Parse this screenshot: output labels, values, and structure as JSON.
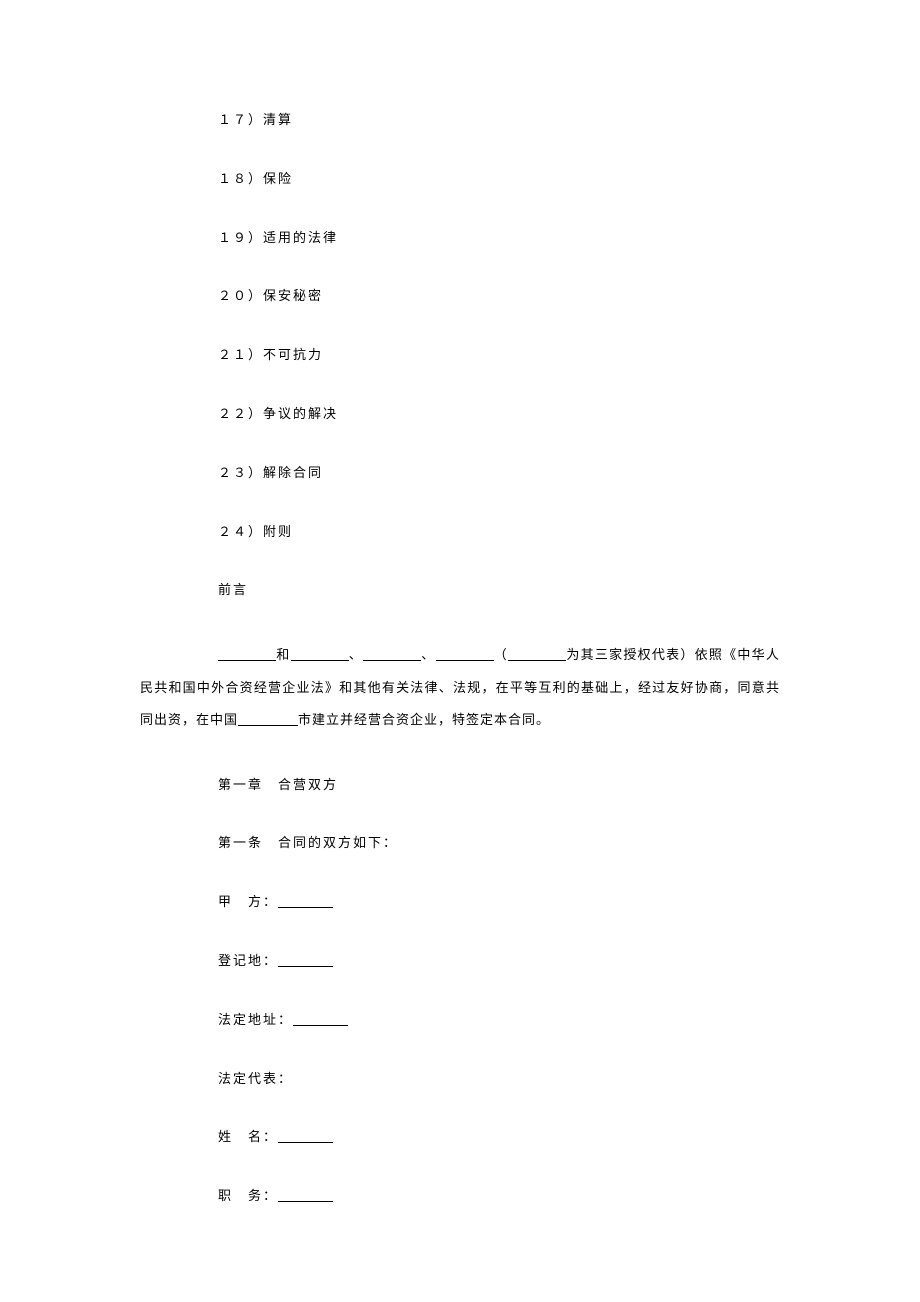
{
  "toc": {
    "item17": "１７）清算",
    "item18": "１８）保险",
    "item19": "１９）适用的法律",
    "item20": "２０）保安秘密",
    "item21": "２１）不可抗力",
    "item22": "２２）争议的解决",
    "item23": "２３）解除合同",
    "item24": "２４）附则"
  },
  "preface": {
    "label": "前言",
    "p1_a": "和",
    "p1_b": "、",
    "p1_c": "、",
    "p1_d": "（",
    "p1_e": "为其三家授权代表）依照《中华人民共和国中外合资经营企业法》和其他有关法律、法规，在平等互利的基础上，经过友好协商，同意共同出资，在中国",
    "p1_f": "市建立并经营合资企业，特签定本合同。"
  },
  "chapter1": {
    "title": "第一章　合营双方",
    "article1": "第一条　合同的双方如下：",
    "party_a_label": "甲　方：",
    "reg_place_label": "登记地：",
    "legal_addr_label": "法定地址：",
    "legal_rep_label": "法定代表：",
    "name_label": "姓　名：",
    "position_label": "职　务："
  }
}
